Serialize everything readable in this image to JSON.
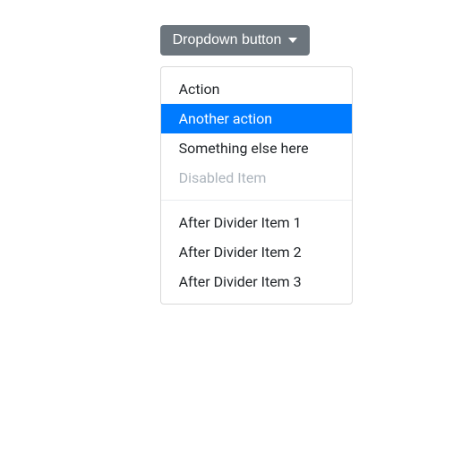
{
  "dropdown": {
    "button_label": "Dropdown button",
    "items": [
      {
        "label": "Action",
        "state": "normal"
      },
      {
        "label": "Another action",
        "state": "active"
      },
      {
        "label": "Something else here",
        "state": "normal"
      },
      {
        "label": "Disabled Item",
        "state": "disabled"
      }
    ],
    "after_divider_items": [
      {
        "label": "After Divider Item 1"
      },
      {
        "label": "After Divider Item 2"
      },
      {
        "label": "After Divider Item 3"
      }
    ]
  }
}
